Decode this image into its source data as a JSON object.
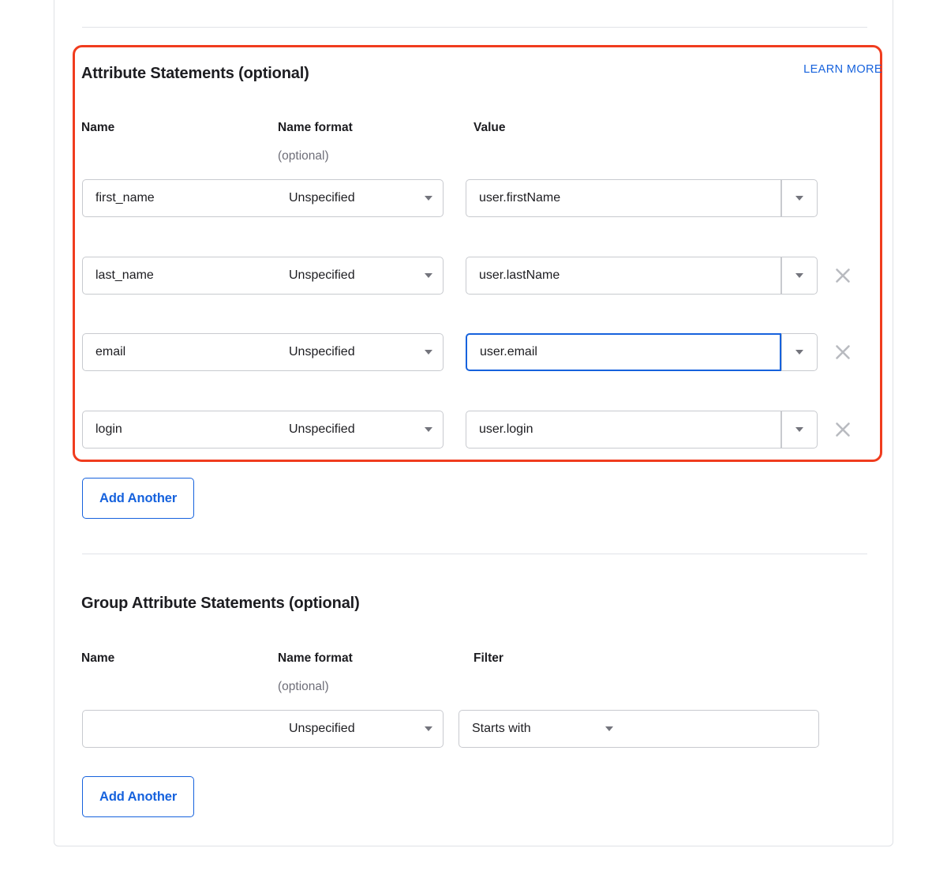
{
  "attribute_statements": {
    "title": "Attribute Statements (optional)",
    "learn_more": "LEARN MORE",
    "columns": {
      "name": "Name",
      "name_format": "Name format",
      "name_format_sub": "(optional)",
      "value": "Value"
    },
    "rows": [
      {
        "name": "first_name",
        "name_format": "Unspecified",
        "value": "user.firstName",
        "removable": false,
        "value_focused": false
      },
      {
        "name": "last_name",
        "name_format": "Unspecified",
        "value": "user.lastName",
        "removable": true,
        "value_focused": false
      },
      {
        "name": "email",
        "name_format": "Unspecified",
        "value": "user.email",
        "removable": true,
        "value_focused": true
      },
      {
        "name": "login",
        "name_format": "Unspecified",
        "value": "user.login",
        "removable": true,
        "value_focused": false
      }
    ],
    "add_another": "Add Another"
  },
  "group_attribute_statements": {
    "title": "Group Attribute Statements (optional)",
    "columns": {
      "name": "Name",
      "name_format": "Name format",
      "name_format_sub": "(optional)",
      "filter": "Filter"
    },
    "rows": [
      {
        "name": "",
        "name_format": "Unspecified",
        "filter_type": "Starts with",
        "filter_value": ""
      }
    ],
    "add_another": "Add Another"
  },
  "icons": {
    "remove": "close-x-icon",
    "caret": "chevron-down-icon"
  },
  "colors": {
    "highlight_border": "#f03c1e",
    "link_blue": "#1662dd",
    "focus_blue": "#1662dd",
    "field_border": "#c8cacf",
    "text_primary": "#1d1d21",
    "text_muted": "#6e6e78"
  }
}
